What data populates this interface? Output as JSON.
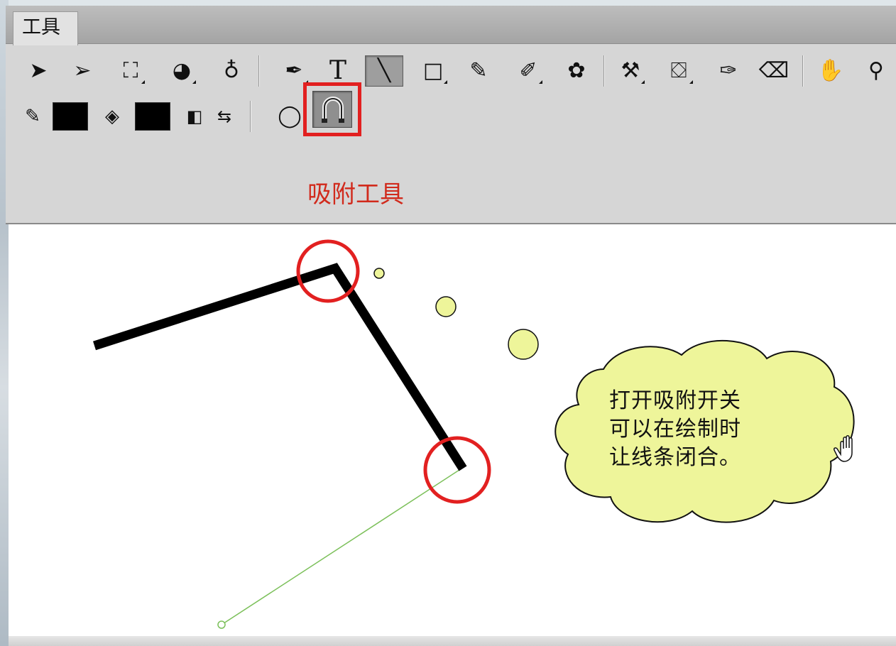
{
  "panel": {
    "tab_label": "工具"
  },
  "toolbar_row1": {
    "tools": [
      {
        "name": "selection-tool",
        "glyph": "➤"
      },
      {
        "name": "subselection-tool",
        "glyph": "➢"
      },
      {
        "name": "free-transform-tool",
        "glyph": "⛶"
      },
      {
        "name": "3d-rotation-tool",
        "glyph": "◕"
      },
      {
        "name": "lasso-tool",
        "glyph": "♁"
      },
      {
        "name": "pen-tool",
        "glyph": "✒"
      },
      {
        "name": "text-tool",
        "glyph": "T"
      },
      {
        "name": "line-tool",
        "glyph": "╲"
      },
      {
        "name": "rectangle-tool",
        "glyph": "□"
      },
      {
        "name": "pencil-tool",
        "glyph": "✎"
      },
      {
        "name": "brush-tool",
        "glyph": "✐"
      },
      {
        "name": "deco-tool",
        "glyph": "✿"
      },
      {
        "name": "bone-tool",
        "glyph": "⚒"
      },
      {
        "name": "paint-bucket-tool",
        "glyph": "⛋"
      },
      {
        "name": "eyedropper-tool",
        "glyph": "✑"
      },
      {
        "name": "eraser-tool",
        "glyph": "⌫"
      },
      {
        "name": "hand-tool",
        "glyph": "✋"
      },
      {
        "name": "zoom-tool",
        "glyph": "⚲"
      }
    ]
  },
  "toolbar_row2": {
    "stroke_color_icon": "✎",
    "fill_color_icon": "◈",
    "stroke_color": "#000000",
    "fill_color": "#000000",
    "default_colors_glyph": "◧",
    "swap_colors_glyph": "⇆",
    "object_drawing_glyph": "◯",
    "snap_glyph": "∩"
  },
  "annotation": {
    "label": "吸附工具",
    "color": "#d12a1c"
  },
  "callout": {
    "lines": [
      "打开吸附开关",
      "可以在绘制时",
      "让线条闭合。"
    ],
    "fill": "#eef59a"
  },
  "colors": {
    "stroke": "#000000",
    "guide_line": "#7cc05a",
    "highlight_circle": "#e22020"
  }
}
